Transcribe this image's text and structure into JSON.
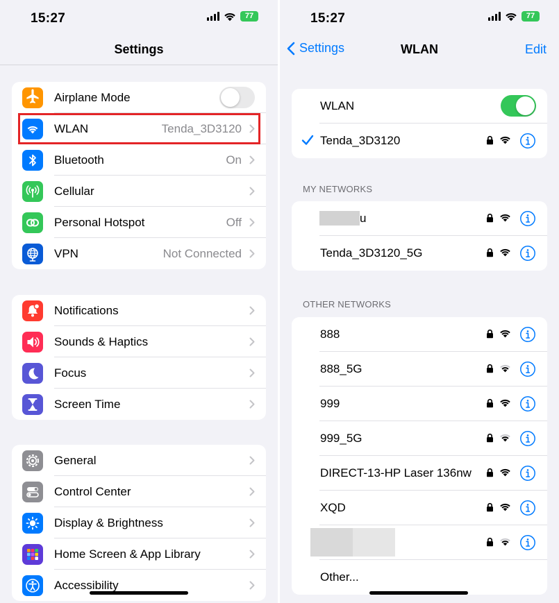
{
  "left": {
    "status": {
      "time": "15:27",
      "battery": "77"
    },
    "nav": {
      "title": "Settings"
    },
    "groups": [
      [
        {
          "label": "Airplane Mode",
          "value": "",
          "icon": "airplane-icon",
          "color": "#ff9500",
          "control": "toggle-off"
        },
        {
          "label": "WLAN",
          "value": "Tenda_3D3120",
          "icon": "wifi-icon",
          "color": "#007aff",
          "control": "chevron"
        },
        {
          "label": "Bluetooth",
          "value": "On",
          "icon": "bluetooth-icon",
          "color": "#007aff",
          "control": "chevron"
        },
        {
          "label": "Cellular",
          "value": "",
          "icon": "antenna-icon",
          "color": "#34c759",
          "control": "chevron"
        },
        {
          "label": "Personal Hotspot",
          "value": "Off",
          "icon": "link-icon",
          "color": "#34c759",
          "control": "chevron"
        },
        {
          "label": "VPN",
          "value": "Not Connected",
          "icon": "globe-icon",
          "color": "#0a5bd6",
          "control": "chevron"
        }
      ],
      [
        {
          "label": "Notifications",
          "value": "",
          "icon": "bell-icon",
          "color": "#ff3b30",
          "control": "chevron"
        },
        {
          "label": "Sounds & Haptics",
          "value": "",
          "icon": "speaker-icon",
          "color": "#ff2d55",
          "control": "chevron"
        },
        {
          "label": "Focus",
          "value": "",
          "icon": "moon-icon",
          "color": "#5856d6",
          "control": "chevron"
        },
        {
          "label": "Screen Time",
          "value": "",
          "icon": "hourglass-icon",
          "color": "#5856d6",
          "control": "chevron"
        }
      ],
      [
        {
          "label": "General",
          "value": "",
          "icon": "gear-icon",
          "color": "#8e8e93",
          "control": "chevron"
        },
        {
          "label": "Control Center",
          "value": "",
          "icon": "switches-icon",
          "color": "#8e8e93",
          "control": "chevron"
        },
        {
          "label": "Display & Brightness",
          "value": "",
          "icon": "sun-icon",
          "color": "#007aff",
          "control": "chevron"
        },
        {
          "label": "Home Screen & App Library",
          "value": "",
          "icon": "grid-icon",
          "color": "#5e3bd8",
          "control": "chevron"
        },
        {
          "label": "Accessibility",
          "value": "",
          "icon": "accessibility-icon",
          "color": "#007aff",
          "control": "chevron"
        }
      ]
    ]
  },
  "right": {
    "status": {
      "time": "15:27",
      "battery": "77"
    },
    "nav": {
      "back": "Settings",
      "title": "WLAN",
      "edit": "Edit"
    },
    "wlan_toggle_label": "WLAN",
    "connected": {
      "name": "Tenda_3D3120",
      "signal": "full"
    },
    "my_networks_header": "MY NETWORKS",
    "my_networks": [
      {
        "name": "u",
        "signal": "full",
        "redacted": true
      },
      {
        "name": "Tenda_3D3120_5G",
        "signal": "full",
        "redacted": false
      }
    ],
    "other_networks_header": "OTHER NETWORKS",
    "other_networks": [
      {
        "name": "888",
        "signal": "full",
        "redacted": false
      },
      {
        "name": "888_5G",
        "signal": "low",
        "redacted": false
      },
      {
        "name": "999",
        "signal": "full",
        "redacted": false
      },
      {
        "name": "999_5G",
        "signal": "low",
        "redacted": false
      },
      {
        "name": "DIRECT-13-HP Laser 136nw",
        "signal": "full",
        "redacted": false
      },
      {
        "name": "XQD",
        "signal": "full",
        "redacted": false
      },
      {
        "name": "",
        "signal": "low",
        "redacted": true
      }
    ],
    "other_label": "Other...",
    "colors": {
      "accent": "#007aff",
      "toggle_on": "#34c759",
      "highlight": "#e32527"
    }
  }
}
